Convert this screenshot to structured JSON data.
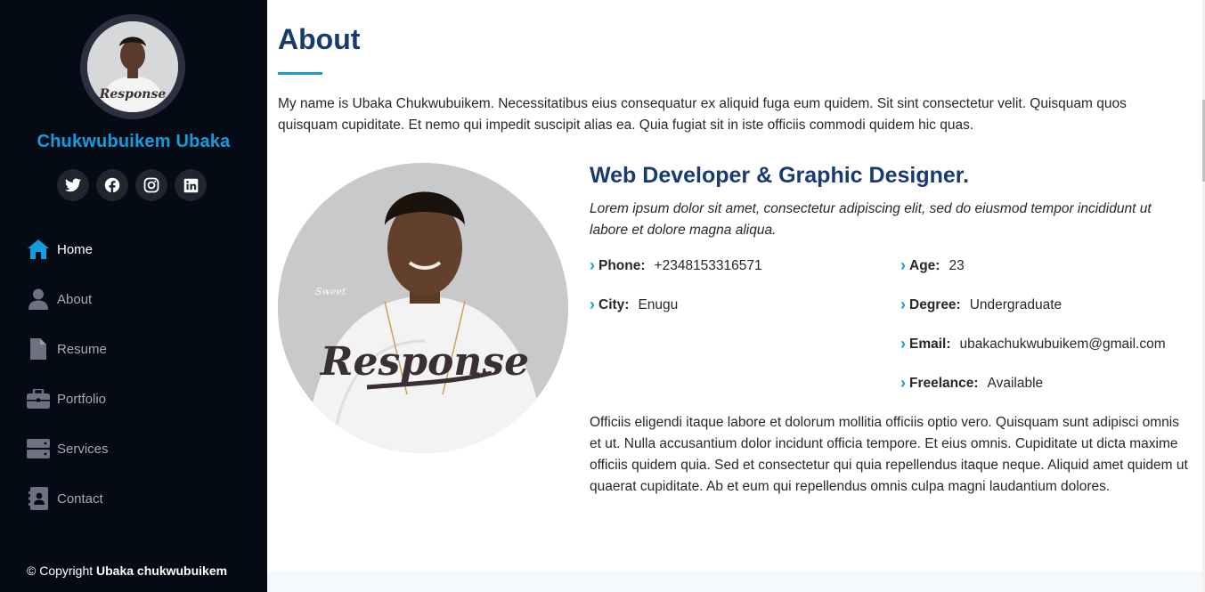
{
  "sidebar": {
    "name": "Chukwubuikem Ubaka",
    "socials": [
      {
        "icon": "twitter-icon"
      },
      {
        "icon": "facebook-icon"
      },
      {
        "icon": "instagram-icon"
      },
      {
        "icon": "linkedin-icon"
      }
    ],
    "nav": [
      {
        "label": "Home",
        "icon": "home-icon",
        "active": true
      },
      {
        "label": "About",
        "icon": "user-icon"
      },
      {
        "label": "Resume",
        "icon": "file-icon"
      },
      {
        "label": "Portfolio",
        "icon": "briefcase-icon"
      },
      {
        "label": "Services",
        "icon": "server-icon"
      },
      {
        "label": "Contact",
        "icon": "contact-card-icon"
      }
    ],
    "copyright_prefix": "© Copyright",
    "copyright_name": "Ubaka chukwubuikem"
  },
  "about": {
    "title": "About",
    "intro": "My name is Ubaka Chukwubuikem. Necessitatibus eius consequatur ex aliquid fuga eum quidem. Sit sint consectetur velit. Quisquam quos quisquam cupiditate. Et nemo qui impedit suscipit alias ea. Quia fugiat sit in iste officiis commodi quidem hic quas.",
    "role": "Web Developer & Graphic Designer.",
    "lead": "Lorem ipsum dolor sit amet, consectetur adipiscing elit, sed do eiusmod tempor incididunt ut labore et dolore magna aliqua.",
    "info": {
      "phone_label": "Phone:",
      "phone": "+2348153316571",
      "city_label": "City:",
      "city": "Enugu",
      "age_label": "Age:",
      "age": "23",
      "degree_label": "Degree:",
      "degree": "Undergraduate",
      "email_label": "Email:",
      "email": "ubakachukwubuikem@gmail.com",
      "freelance_label": "Freelance:",
      "freelance": "Available"
    },
    "description": "Officiis eligendi itaque labore et dolorum mollitia officiis optio vero. Quisquam sunt adipisci omnis et ut. Nulla accusantium dolor incidunt officia tempore. Et eius omnis. Cupiditate ut dicta maxime officiis quidem quia. Sed et consectetur qui quia repellendus itaque neque. Aliquid amet quidem ut quaerat cupiditate. Ab et eum qui repellendus omnis culpa magni laudantium dolores.",
    "shirt_text": "Response"
  },
  "colors": {
    "accent": "#149ddd",
    "heading": "#173b6c",
    "sidebar_bg": "#040b14",
    "nav_text": "#a8a9b4"
  }
}
